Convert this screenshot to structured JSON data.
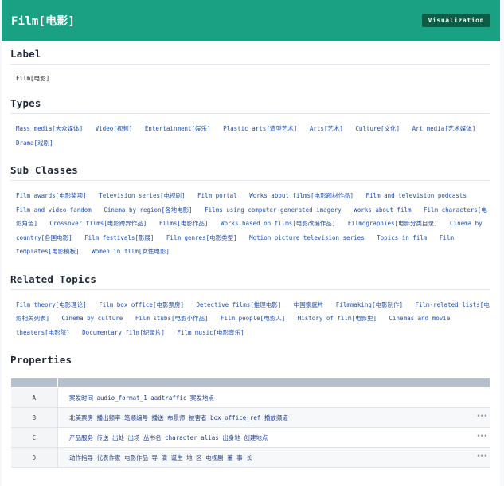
{
  "header": {
    "title": "Film[电影]",
    "viz_button": "Visualization"
  },
  "sections": {
    "label": {
      "heading": "Label",
      "value": "Film[电影]"
    },
    "types": {
      "heading": "Types",
      "items": [
        "Mass media[大众媒体]",
        "Video[视频]",
        "Entertainment[娱乐]",
        "Plastic arts[造型艺术]",
        "Arts[艺术]",
        "Culture[文化]",
        "Art media[艺术媒体]",
        "Drama[戏剧]"
      ]
    },
    "subclasses": {
      "heading": "Sub Classes",
      "items": [
        "Film awards[电影奖项]",
        "Television series[电视剧]",
        "Film portal",
        "Works about films[电影题材作品]",
        "Film and television podcasts",
        "Film and video fandom",
        "Cinema by region[各地电影]",
        "Films using computer-generated imagery",
        "Works about film",
        "Film characters[电影角色]",
        "Crossover films[电影跨界作品]",
        "Films[电影作品]",
        "Works based on films[电影改编作品]",
        "Filmographies[电影分类目录]",
        "Cinema by country[各国电影]",
        "Film festivals[影展]",
        "Film genres[电影类型]",
        "Motion picture television series",
        "Topics in film",
        "Film templates[电影模板]",
        "Women in film[女性电影]"
      ]
    },
    "related": {
      "heading": "Related Topics",
      "items": [
        "Film theory[电影理论]",
        "Film box office[电影票房]",
        "Detective films[推理电影]",
        "中国家庭片",
        "Filmmaking[电影制作]",
        "Film-related lists[电影相关列表]",
        "Cinema by culture",
        "Film stubs[电影小作品]",
        "Film people[电影人]",
        "History of film[电影史]",
        "Cinemas and movie theaters[电影院]",
        "Documentary film[纪录片]",
        "Film music[电影音乐]"
      ]
    },
    "properties": {
      "heading": "Properties",
      "rows": [
        {
          "key": "A",
          "value": "案发时间 audio_format_1 aadtraffic 案发地点",
          "more": false
        },
        {
          "key": "B",
          "value": "北美票房 播出频率 笔顺编号 播送 布景师 被害者 box_office_ref 播放频道",
          "more": true
        },
        {
          "key": "C",
          "value": "产品服务 传送 出处 出场 丛书名 character_alias 出身地 创建地点",
          "more": true
        },
        {
          "key": "D",
          "value": "动作指导 代表作家 电影作品 导 演 诞生 地 区 电视剧 董 事 长",
          "more": true
        }
      ],
      "more_glyph": "•••"
    }
  }
}
